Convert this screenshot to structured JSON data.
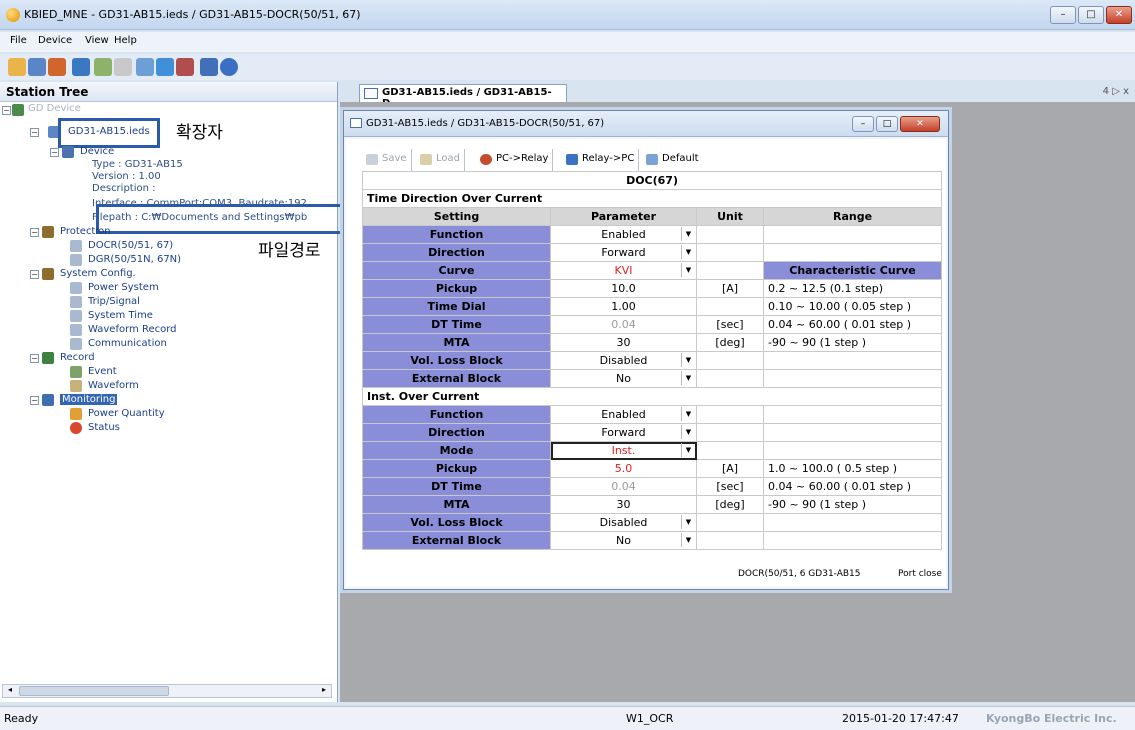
{
  "window": {
    "title": "KBIED_MNE - GD31-AB15.ieds / GD31-AB15-DOCR(50/51, 67)",
    "minimize": "–",
    "maximize": "□",
    "close": "✕"
  },
  "menu": [
    "File",
    "Device",
    "View",
    "Help"
  ],
  "station_tree": {
    "header": "Station Tree",
    "root": "GD Device",
    "file": "GD31-AB15.ieds",
    "device": {
      "label": "Device",
      "type": "Type : GD31-AB15",
      "version": "Version : 1.00",
      "description": "Description :",
      "interface": "Interface : CommPort:COM3, Baudrate:192",
      "filepath": "Filepath : C:₩Documents and Settings₩pb"
    },
    "protection": {
      "label": "Protection",
      "items": [
        "DOCR(50/51, 67)",
        "DGR(50/51N, 67N)"
      ]
    },
    "system_config": {
      "label": "System Config.",
      "items": [
        "Power System",
        "Trip/Signal",
        "System Time",
        "Waveform Record",
        "Communication"
      ]
    },
    "record": {
      "label": "Record",
      "items": [
        "Event",
        "Waveform"
      ]
    },
    "monitoring": {
      "label": "Monitoring",
      "items": [
        "Power Quantity",
        "Status"
      ]
    },
    "annotation_ext": "확장자",
    "annotation_path": "파일경로"
  },
  "doc_tab": {
    "label": "GD31-AB15.ieds / GD31-AB15-D...",
    "controls": "4 ▷ x"
  },
  "child_window": {
    "title": "GD31-AB15.ieds / GD31-AB15-DOCR(50/51, 67)",
    "toolbar": [
      "Save",
      "Load",
      "PC->Relay",
      "Relay->PC",
      "Default"
    ],
    "status_left": "DOCR(50/51, 6 GD31-AB15",
    "status_right": "Port close"
  },
  "table": {
    "title": "DOC(67)",
    "columns": [
      "Setting",
      "Parameter",
      "Unit",
      "Range"
    ],
    "sections": [
      {
        "name": "Time Direction Over Current",
        "rows": [
          {
            "setting": "Function",
            "parameter": "Enabled",
            "unit": "",
            "range": ""
          },
          {
            "setting": "Direction",
            "parameter": "Forward",
            "unit": "",
            "range": ""
          },
          {
            "setting": "Curve",
            "parameter": "KVI",
            "unit": "",
            "range": "Characteristic Curve"
          },
          {
            "setting": "Pickup",
            "parameter": "10.0",
            "unit": "[A]",
            "range": "0.2 ~ 12.5 (0.1 step)"
          },
          {
            "setting": "Time Dial",
            "parameter": "1.00",
            "unit": "",
            "range": "0.10 ~ 10.00 ( 0.05 step )"
          },
          {
            "setting": "DT Time",
            "parameter": "0.04",
            "unit": "[sec]",
            "range": "0.04 ~ 60.00 ( 0.01 step )"
          },
          {
            "setting": "MTA",
            "parameter": "30",
            "unit": "[deg]",
            "range": "-90 ~ 90 (1 step )"
          },
          {
            "setting": "Vol. Loss Block",
            "parameter": "Disabled",
            "unit": "",
            "range": ""
          },
          {
            "setting": "External Block",
            "parameter": "No",
            "unit": "",
            "range": ""
          }
        ]
      },
      {
        "name": "Inst. Over Current",
        "rows": [
          {
            "setting": "Function",
            "parameter": "Enabled",
            "unit": "",
            "range": ""
          },
          {
            "setting": "Direction",
            "parameter": "Forward",
            "unit": "",
            "range": ""
          },
          {
            "setting": "Mode",
            "parameter": "Inst.",
            "unit": "",
            "range": ""
          },
          {
            "setting": "Pickup",
            "parameter": "5.0",
            "unit": "[A]",
            "range": "1.0 ~ 100.0 ( 0.5 step )"
          },
          {
            "setting": "DT Time",
            "parameter": "0.04",
            "unit": "[sec]",
            "range": "0.04 ~ 60.00 ( 0.01 step )"
          },
          {
            "setting": "MTA",
            "parameter": "30",
            "unit": "[deg]",
            "range": "-90 ~ 90 (1 step )"
          },
          {
            "setting": "Vol. Loss Block",
            "parameter": "Disabled",
            "unit": "",
            "range": ""
          },
          {
            "setting": "External Block",
            "parameter": "No",
            "unit": "",
            "range": ""
          }
        ]
      }
    ]
  },
  "statusbar": {
    "left": "Ready",
    "center": "W1_OCR",
    "datetime": "2015-01-20 17:47:47",
    "company": "KyongBo Electric Inc."
  }
}
